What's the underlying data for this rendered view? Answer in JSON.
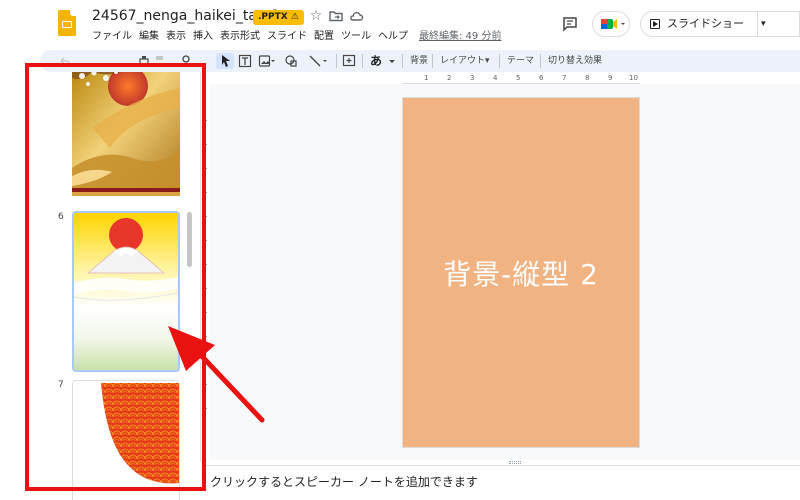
{
  "header": {
    "doc_title": "24567_nenga_haikei_tate2",
    "badge": ".PPTX ⚠",
    "star_icon": "☆",
    "menu": [
      "ファイル",
      "編集",
      "表示",
      "挿入",
      "表示形式",
      "スライド",
      "配置",
      "ツール",
      "ヘルプ"
    ],
    "last_edit": "最終編集: 49 分前",
    "slideshow_label": "スライドショー",
    "slideshow_dropdown": "▾"
  },
  "toolbar": {
    "text_style": "あ",
    "background": "背景",
    "layout": "レイアウト▾",
    "theme": "テーマ",
    "transition": "切り替え効果"
  },
  "ruler": [
    "1",
    "2",
    "3",
    "4",
    "5",
    "6",
    "7",
    "8",
    "9",
    "10"
  ],
  "filmstrip": {
    "slides": [
      {
        "number": "6"
      },
      {
        "number": "7"
      }
    ]
  },
  "main_slide": {
    "text": "背景-縦型 2",
    "background_color": "#f2b382"
  },
  "notes": {
    "placeholder": "クリックするとスピーカー ノートを追加できます"
  },
  "annotation": {
    "box_color": "#ea1111",
    "arrow_color": "#ea1111"
  }
}
